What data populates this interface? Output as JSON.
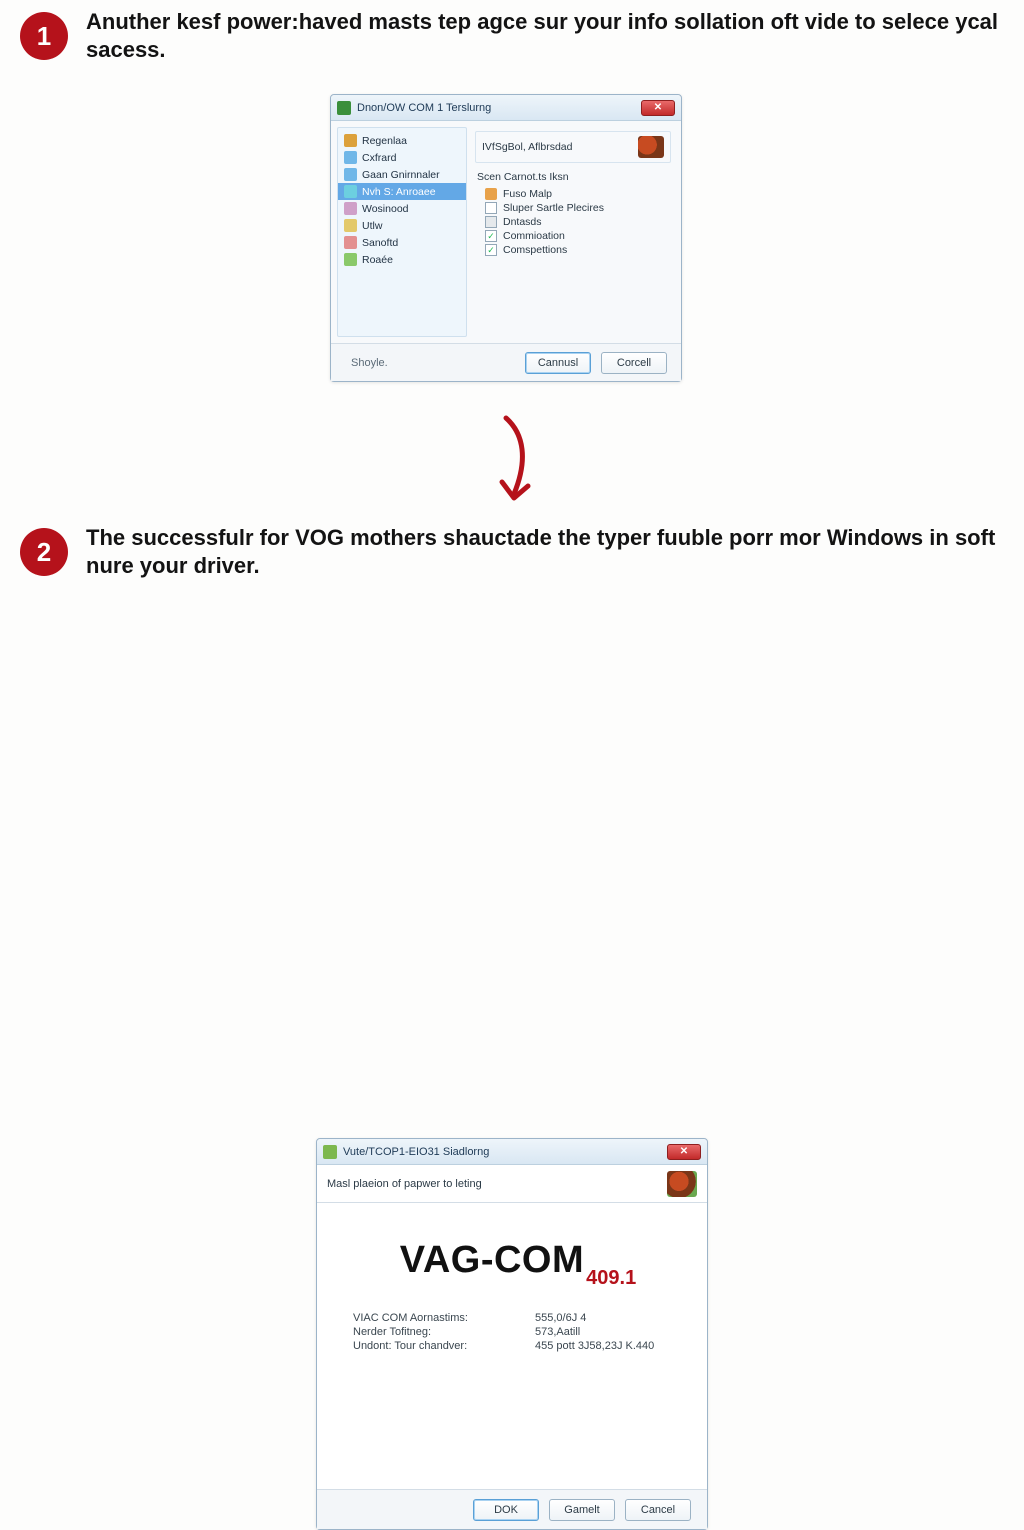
{
  "step1": {
    "number": "1",
    "text": "Anuther kesf power:haved masts tep agce sur your info sollation oft vide to selece ycal sacess."
  },
  "step2": {
    "number": "2",
    "text": "The successfulr for VOG mothers shauctade the typer fuuble porr mor Windows in soft nure your driver."
  },
  "dialog1": {
    "title": "Dnon/OW COM 1 Terslurng",
    "close_glyph": "✕",
    "sidebar": [
      {
        "label": "Regenlaa",
        "iconClass": "ic1"
      },
      {
        "label": "Cxfrard",
        "iconClass": "ic2"
      },
      {
        "label": "Gaan Gnirnnaler",
        "iconClass": "ic3"
      },
      {
        "label": "Nvh S: Anroaee",
        "iconClass": "ic4",
        "selected": true
      },
      {
        "label": "Wosinood",
        "iconClass": "ic5"
      },
      {
        "label": "Utlw",
        "iconClass": "ic6"
      },
      {
        "label": "Sanoftd",
        "iconClass": "ic7"
      },
      {
        "label": "Roaée",
        "iconClass": "ic8"
      }
    ],
    "header_box": "IVfSgBol, Aflbrsdad",
    "group_title": "Scen Carnot.ts Iksn",
    "options": [
      {
        "label": "Fuso Malp",
        "checked": false,
        "iconColor": "#e8a24a",
        "style": "icon"
      },
      {
        "label": "Sluper Sartle Plecires",
        "checked": false,
        "iconColor": "",
        "style": "emptybox"
      },
      {
        "label": "Dntasds",
        "checked": false,
        "iconColor": "",
        "style": "graybox"
      },
      {
        "label": "Commioation",
        "checked": true,
        "iconColor": "",
        "style": "check"
      },
      {
        "label": "Comspettions",
        "checked": true,
        "iconColor": "",
        "style": "check"
      }
    ],
    "footer_link": "Shoyle.",
    "btn_primary": "Cannusl",
    "btn_secondary": "Corcell"
  },
  "dialog2": {
    "title": "Vute/TCOP1-EIO31 Siadlorng",
    "close_glyph": "✕",
    "subtitle": "Masl plaeion of papwer to leting",
    "logo_main": "VAG-COM",
    "logo_ver": "409.1",
    "info": [
      {
        "k": "VIAC COM Aornastims:",
        "v": "555,0/6J 4"
      },
      {
        "k": "Nerder Tofitneg:",
        "v": "573,Aatill"
      },
      {
        "k": "Undont: Tour chandver:",
        "v": "455 pott 3J58,23J K.440"
      }
    ],
    "btn_ok": "DOK",
    "btn_mid": "Gamelt",
    "btn_cancel": "Cancel"
  }
}
